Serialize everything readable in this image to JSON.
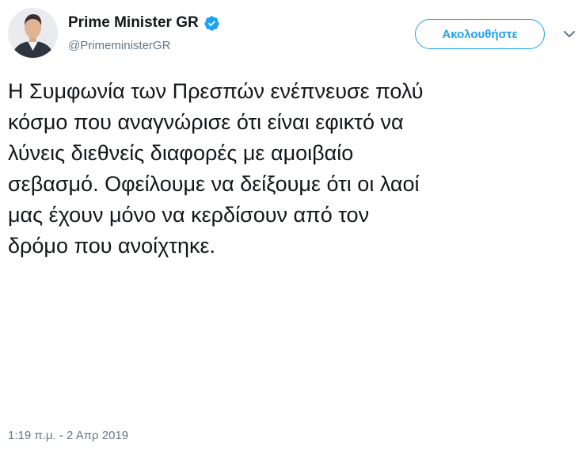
{
  "author": {
    "display_name": "Prime Minister GR",
    "handle": "@PrimeministerGR",
    "verified": true,
    "verified_icon": "verified-badge-icon",
    "avatar_icon": "profile-photo-avatar"
  },
  "actions": {
    "follow_label": "Ακολουθήστε",
    "more_icon": "chevron-down-icon"
  },
  "tweet": {
    "text": "Η Συμφωνία των Πρεσπών ενέπνευσε πολύ\nκόσμο που αναγνώρισε ότι είναι εφικτό να\nλύνεις διεθνείς διαφορές με αμοιβαίο\nσεβασμό. Οφείλουμε να δείξουμε ότι οι λαοί\nμας έχουν μόνο να κερδίσουν από τον\nδρόμο που ανοίχτηκε.",
    "timestamp": "1:19 π.μ. - 2 Απρ 2019"
  },
  "colors": {
    "accent": "#1da1f2",
    "text_primary": "#14171a",
    "text_secondary": "#657786"
  }
}
